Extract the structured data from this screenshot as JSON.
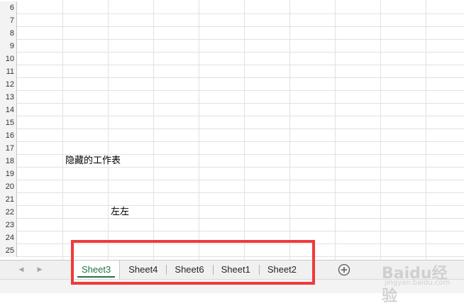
{
  "spreadsheet": {
    "rows": [
      {
        "num": "6",
        "cells": []
      },
      {
        "num": "7",
        "cells": []
      },
      {
        "num": "8",
        "cells": []
      },
      {
        "num": "9",
        "cells": []
      },
      {
        "num": "10",
        "cells": []
      },
      {
        "num": "11",
        "cells": []
      },
      {
        "num": "12",
        "cells": []
      },
      {
        "num": "13",
        "cells": []
      },
      {
        "num": "14",
        "cells": []
      },
      {
        "num": "15",
        "cells": []
      },
      {
        "num": "16",
        "cells": []
      },
      {
        "num": "17",
        "cells": []
      },
      {
        "num": "18",
        "cells": [
          {
            "col": "B",
            "text": "隐藏的工作表"
          }
        ]
      },
      {
        "num": "19",
        "cells": []
      },
      {
        "num": "20",
        "cells": []
      },
      {
        "num": "21",
        "cells": []
      },
      {
        "num": "22",
        "cells": [
          {
            "col": "C",
            "text": "左左"
          }
        ]
      },
      {
        "num": "23",
        "cells": []
      },
      {
        "num": "24",
        "cells": []
      },
      {
        "num": "25",
        "cells": []
      }
    ]
  },
  "sheet_tabs": {
    "active_index": 0,
    "tabs": [
      {
        "label": "Sheet3"
      },
      {
        "label": "Sheet4"
      },
      {
        "label": "Sheet6"
      },
      {
        "label": "Sheet1"
      },
      {
        "label": "Sheet2"
      }
    ],
    "nav_prev_icon": "triangle-left-icon",
    "nav_next_icon": "triangle-right-icon",
    "add_icon": "plus-circle-icon"
  },
  "colors": {
    "active_tab_text": "#217346",
    "highlight_border": "#f03a3a",
    "gridline": "#e1e1e1"
  },
  "watermark": {
    "line1": "Baidu经验",
    "line2": "jingyan.baidu.com"
  }
}
